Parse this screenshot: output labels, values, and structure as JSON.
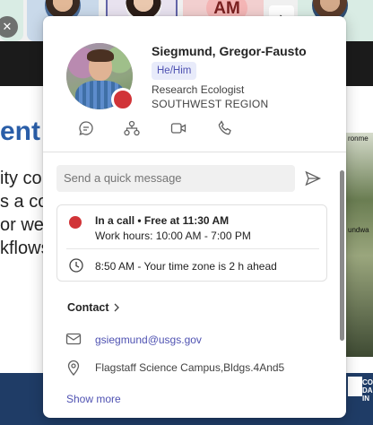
{
  "background": {
    "thumb_initials": "AM",
    "slide_title": "ent I",
    "slide_lines": [
      "ity co",
      "s a co",
      "or well",
      "kflows"
    ],
    "slide_caption_top": "ronme",
    "slide_caption_bottom": "undwa",
    "footer_text": "CO DA IN"
  },
  "profile": {
    "name": "Siegmund, Gregor-Fausto",
    "pronouns": "He/Him",
    "job_title": "Research Ecologist",
    "department": "SOUTHWEST REGION",
    "presence_color": "#d13438"
  },
  "actions": {
    "chat_icon": "chat-icon",
    "org_icon": "org-chart-icon",
    "video_icon": "video-call-icon",
    "call_icon": "phone-icon"
  },
  "message": {
    "placeholder": "Send a quick message"
  },
  "status": {
    "line": "In a call • Free at 11:30 AM",
    "work_hours": "Work hours: 10:00 AM - 7:00 PM",
    "timezone": "8:50 AM - Your time zone is 2 h ahead"
  },
  "contact": {
    "heading": "Contact",
    "email": "gsiegmund@usgs.gov",
    "location": "Flagstaff Science Campus,Bldgs.4And5",
    "show_more": "Show more"
  },
  "colors": {
    "accent": "#4f52b2",
    "busy": "#d13438"
  }
}
